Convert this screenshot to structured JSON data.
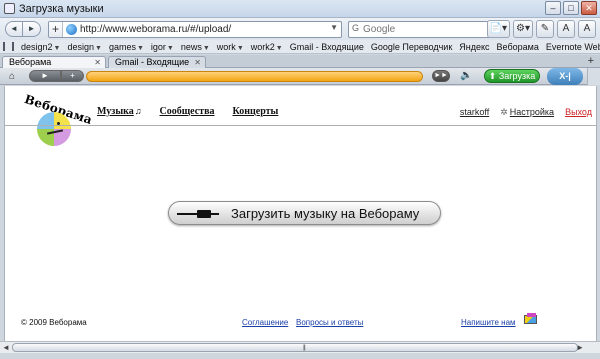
{
  "window": {
    "title": "Загрузка музыки",
    "controls": [
      "–",
      "□",
      "✕"
    ]
  },
  "toolbar": {
    "back_icon": "◄",
    "forward_icon": "►",
    "add_icon": "+",
    "url": "http://www.weborama.ru/#/upload/",
    "dropdown_icon": "▼",
    "search_placeholder": "Google",
    "search_icon": "G",
    "right_icons": [
      "📄▾",
      "⚙▾",
      "✎",
      "A",
      "A"
    ]
  },
  "bookmarks": {
    "items": [
      {
        "label": "design2",
        "has_arrow": true
      },
      {
        "label": "design",
        "has_arrow": true
      },
      {
        "label": "games",
        "has_arrow": true
      },
      {
        "label": "igor",
        "has_arrow": true
      },
      {
        "label": "news",
        "has_arrow": true
      },
      {
        "label": "work",
        "has_arrow": true
      },
      {
        "label": "work2",
        "has_arrow": true
      },
      {
        "label": "Gmail - Входящие",
        "has_arrow": false
      },
      {
        "label": "Google Переводчик",
        "has_arrow": false
      },
      {
        "label": "Яндекс",
        "has_arrow": false
      },
      {
        "label": "Веборама",
        "has_arrow": false
      },
      {
        "label": "Evernote Web",
        "has_arrow": false
      }
    ],
    "arrow": "▼"
  },
  "tabs": [
    {
      "label": "Веборама",
      "active": true
    },
    {
      "label": "Gmail - Входящие",
      "active": false
    }
  ],
  "tab_close": "✕",
  "new_tab": "+",
  "player": {
    "home_icon": "⌂",
    "play_icon": "►",
    "add_icon": "+",
    "next_icon": "►►",
    "volume_icon": "🔈",
    "upload_label": "⬆ Загрузка",
    "brand_label": "X-|"
  },
  "site": {
    "logo_text": "Веборама",
    "nav": [
      {
        "label": "Музыка",
        "note": "♫"
      },
      {
        "label": "Сообщества",
        "note": ""
      },
      {
        "label": "Концерты",
        "note": ""
      }
    ],
    "user": "starkoff",
    "settings": "Настройка",
    "logout": "Выход",
    "upload_button": "Загрузить музыку на Вебораму",
    "footer": {
      "copyright": "© 2009 Веборама",
      "agreement": "Соглашение",
      "faq": "Вопросы и ответы",
      "contact": "Напишите нам"
    }
  },
  "scrollbar": {
    "left": "◄",
    "right": "►",
    "grip": "|||"
  }
}
